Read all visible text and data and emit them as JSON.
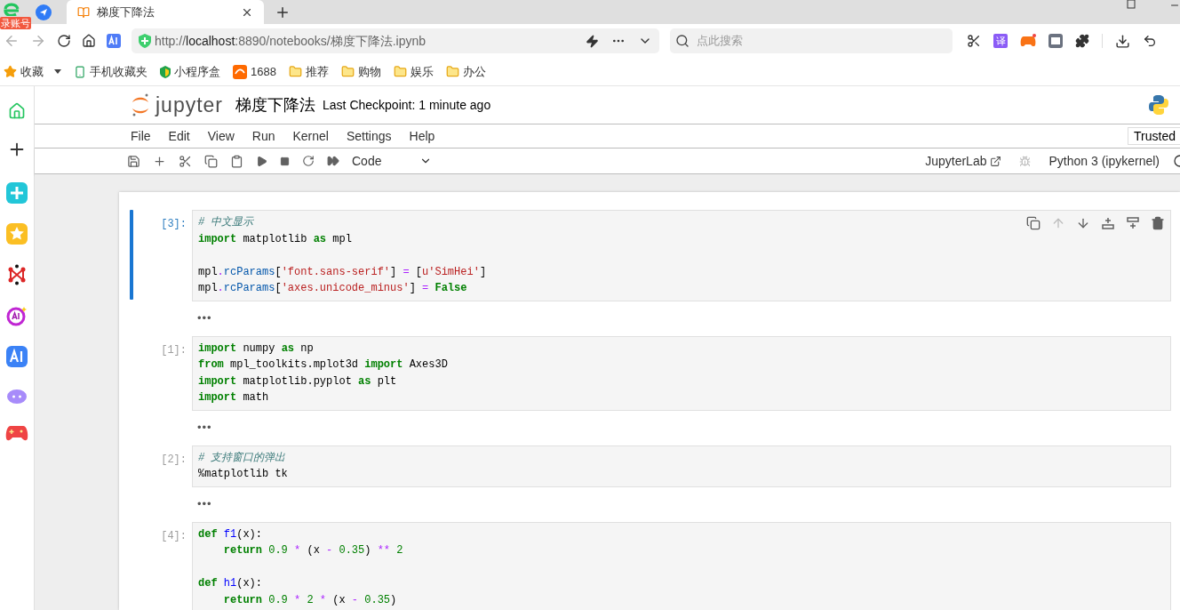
{
  "browser": {
    "badge": "录账号",
    "tabs": [
      {
        "title": "梯度下降法",
        "selected": true
      }
    ],
    "url": {
      "scheme": "http://",
      "host": "localhost",
      "path": ":8890/notebooks/梯度下降法.ipynb"
    },
    "search": {
      "placeholder": "点此搜索"
    },
    "extension_label": "译",
    "bookmarks": [
      {
        "kind": "star",
        "label": "收藏"
      },
      {
        "kind": "phone",
        "label": "手机收藏夹"
      },
      {
        "kind": "shield",
        "label": "小程序盒"
      },
      {
        "kind": "tao",
        "label": "1688"
      },
      {
        "kind": "folder",
        "label": "推荐"
      },
      {
        "kind": "folder",
        "label": "购物"
      },
      {
        "kind": "folder",
        "label": "娱乐"
      },
      {
        "kind": "folder",
        "label": "办公"
      }
    ]
  },
  "notebook": {
    "logo_text": "jupyter",
    "title": "梯度下降法",
    "checkpoint": "Last Checkpoint: 1 minute ago",
    "menu": [
      "File",
      "Edit",
      "View",
      "Run",
      "Kernel",
      "Settings",
      "Help"
    ],
    "trusted": "Trusted",
    "cell_type": "Code",
    "jupyterlab_link": "JupyterLab",
    "kernel": "Python 3 (ipykernel)",
    "cells": [
      {
        "prompt": "[3]:",
        "selected": true,
        "output_placeholder": "•••",
        "lines": [
          {
            "tokens": [
              {
                "kind": "comment",
                "text": "# 中文显示"
              }
            ]
          },
          {
            "tokens": [
              {
                "kind": "keyword",
                "text": "import"
              },
              {
                "kind": "plain",
                "text": " matplotlib "
              },
              {
                "kind": "keyword",
                "text": "as"
              },
              {
                "kind": "plain",
                "text": " mpl"
              }
            ]
          },
          {
            "gap_before": true,
            "tokens": [
              {
                "kind": "plain",
                "text": "mpl"
              },
              {
                "kind": "op",
                "text": "."
              },
              {
                "kind": "attr",
                "text": "rcParams"
              },
              {
                "kind": "punct",
                "text": "["
              },
              {
                "kind": "string",
                "text": "'font.sans-serif'"
              },
              {
                "kind": "punct",
                "text": "] "
              },
              {
                "kind": "op",
                "text": "="
              },
              {
                "kind": "punct",
                "text": " ["
              },
              {
                "kind": "string",
                "text": "u'SimHei'"
              },
              {
                "kind": "punct",
                "text": "]"
              }
            ]
          },
          {
            "tokens": [
              {
                "kind": "plain",
                "text": "mpl"
              },
              {
                "kind": "op",
                "text": "."
              },
              {
                "kind": "attr",
                "text": "rcParams"
              },
              {
                "kind": "punct",
                "text": "["
              },
              {
                "kind": "string",
                "text": "'axes.unicode_minus'"
              },
              {
                "kind": "punct",
                "text": "] "
              },
              {
                "kind": "op",
                "text": "= "
              },
              {
                "kind": "keyword",
                "text": "False"
              }
            ]
          }
        ]
      },
      {
        "prompt": "[1]:",
        "selected": false,
        "output_placeholder": "•••",
        "lines": [
          {
            "tokens": [
              {
                "kind": "keyword",
                "text": "import"
              },
              {
                "kind": "plain",
                "text": " numpy "
              },
              {
                "kind": "keyword",
                "text": "as"
              },
              {
                "kind": "plain",
                "text": " np"
              }
            ]
          },
          {
            "tokens": [
              {
                "kind": "keyword",
                "text": "from"
              },
              {
                "kind": "plain",
                "text": " mpl_toolkits.mplot3d "
              },
              {
                "kind": "keyword",
                "text": "import"
              },
              {
                "kind": "plain",
                "text": " Axes3D"
              }
            ]
          },
          {
            "tokens": [
              {
                "kind": "keyword",
                "text": "import"
              },
              {
                "kind": "plain",
                "text": " matplotlib.pyplot "
              },
              {
                "kind": "keyword",
                "text": "as"
              },
              {
                "kind": "plain",
                "text": " plt"
              }
            ]
          },
          {
            "tokens": [
              {
                "kind": "keyword",
                "text": "import"
              },
              {
                "kind": "plain",
                "text": " math"
              }
            ]
          }
        ]
      },
      {
        "prompt": "[2]:",
        "selected": false,
        "output_placeholder": "•••",
        "lines": [
          {
            "tokens": [
              {
                "kind": "comment",
                "text": "# 支持窗口的弹出"
              }
            ]
          },
          {
            "tokens": [
              {
                "kind": "plain",
                "text": "%matplotlib tk"
              }
            ]
          }
        ]
      },
      {
        "prompt": "[4]:",
        "selected": false,
        "lines": [
          {
            "tokens": [
              {
                "kind": "keyword",
                "text": "def "
              },
              {
                "kind": "def",
                "text": "f1"
              },
              {
                "kind": "punct",
                "text": "(x):"
              }
            ]
          },
          {
            "tokens": [
              {
                "kind": "keyword",
                "text": "    return "
              },
              {
                "kind": "number",
                "text": "0.9 "
              },
              {
                "kind": "op",
                "text": "* "
              },
              {
                "kind": "plain",
                "text": "(x "
              },
              {
                "kind": "op",
                "text": "- "
              },
              {
                "kind": "number",
                "text": "0.35"
              },
              {
                "kind": "plain",
                "text": ") "
              },
              {
                "kind": "op",
                "text": "** "
              },
              {
                "kind": "number",
                "text": "2"
              }
            ]
          },
          {
            "gap_before": true,
            "tokens": [
              {
                "kind": "keyword",
                "text": "def "
              },
              {
                "kind": "def",
                "text": "h1"
              },
              {
                "kind": "punct",
                "text": "(x):"
              }
            ]
          },
          {
            "tokens": [
              {
                "kind": "keyword",
                "text": "    return "
              },
              {
                "kind": "number",
                "text": "0.9 "
              },
              {
                "kind": "op",
                "text": "* "
              },
              {
                "kind": "number",
                "text": "2 "
              },
              {
                "kind": "op",
                "text": "* "
              },
              {
                "kind": "plain",
                "text": "(x "
              },
              {
                "kind": "op",
                "text": "- "
              },
              {
                "kind": "number",
                "text": "0.35"
              },
              {
                "kind": "plain",
                "text": ")"
              }
            ]
          }
        ]
      }
    ]
  }
}
